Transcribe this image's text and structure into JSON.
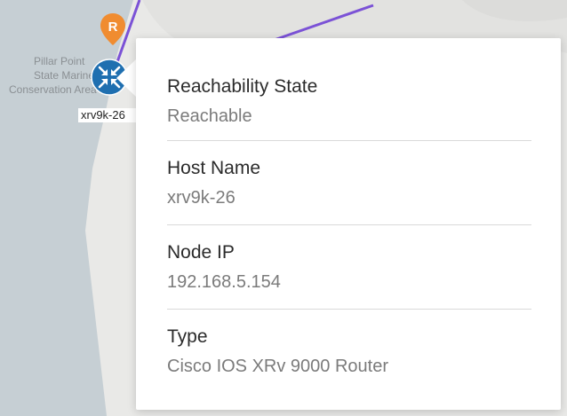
{
  "map": {
    "park_label_line1": "Pillar Point",
    "park_label_line2": "State Marine",
    "park_label_line3": "Conservation Area",
    "node_tag": "xrv9k-26",
    "pin_letter": "R",
    "colors": {
      "water": "#c6cfd4",
      "land": "#e9e9e7",
      "link": "#7b52d6",
      "pin": "#f08c30",
      "router": "#1f6fb0"
    }
  },
  "popover": {
    "fields": [
      {
        "label": "Reachability State",
        "value": "Reachable"
      },
      {
        "label": "Host Name",
        "value": "xrv9k-26"
      },
      {
        "label": "Node IP",
        "value": "192.168.5.154"
      },
      {
        "label": "Type",
        "value": "Cisco IOS XRv 9000 Router"
      }
    ]
  },
  "icons": {
    "router": "router-icon",
    "pin": "map-pin-icon"
  }
}
